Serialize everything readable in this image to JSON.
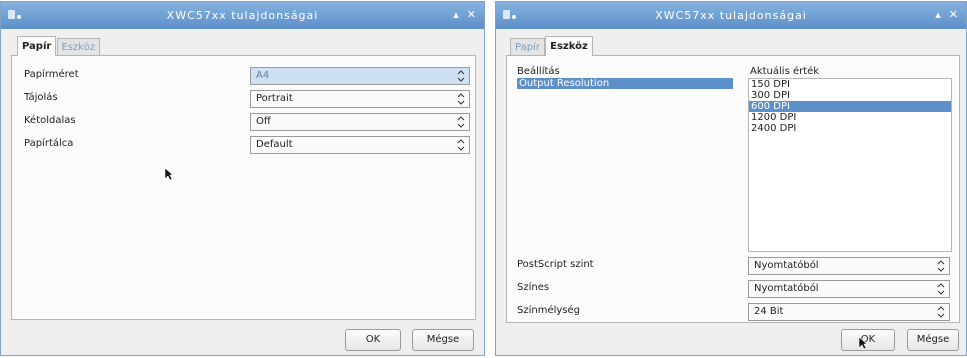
{
  "dialog1": {
    "title": "XWC57xx tulajdonságai",
    "tabs": [
      "Papír",
      "Eszköz"
    ],
    "rows": [
      {
        "label": "Papírméret",
        "value": "A4"
      },
      {
        "label": "Tájolás",
        "value": "Portrait"
      },
      {
        "label": "Kétoldalas",
        "value": "Off"
      },
      {
        "label": "Papírtálca",
        "value": "Default"
      }
    ],
    "ok": "OK",
    "cancel": "Mégse"
  },
  "dialog2": {
    "title": "XWC57xx tulajdonságai",
    "tabs": [
      "Papír",
      "Eszköz"
    ],
    "settings_header": "Beállítás",
    "settings": [
      "Output Resolution"
    ],
    "value_header": "Aktuális érték",
    "values": [
      "150 DPI",
      "300 DPI",
      "600 DPI",
      "1200 DPI",
      "2400 DPI"
    ],
    "selected_value_index": 2,
    "rows": [
      {
        "label": "PostScript szint",
        "value": "Nyomtatóból"
      },
      {
        "label": "Színes",
        "value": "Nyomtatóból"
      },
      {
        "label": "Színmélység",
        "value": "24 Bit"
      }
    ],
    "ok": "OK",
    "cancel": "Mégse"
  },
  "icons": {
    "menu": "window-menu-icon",
    "shade": "shade-icon",
    "close": "close-icon",
    "combo": "combo-arrows-icon",
    "cursor": "mouse-pointer-icon"
  }
}
